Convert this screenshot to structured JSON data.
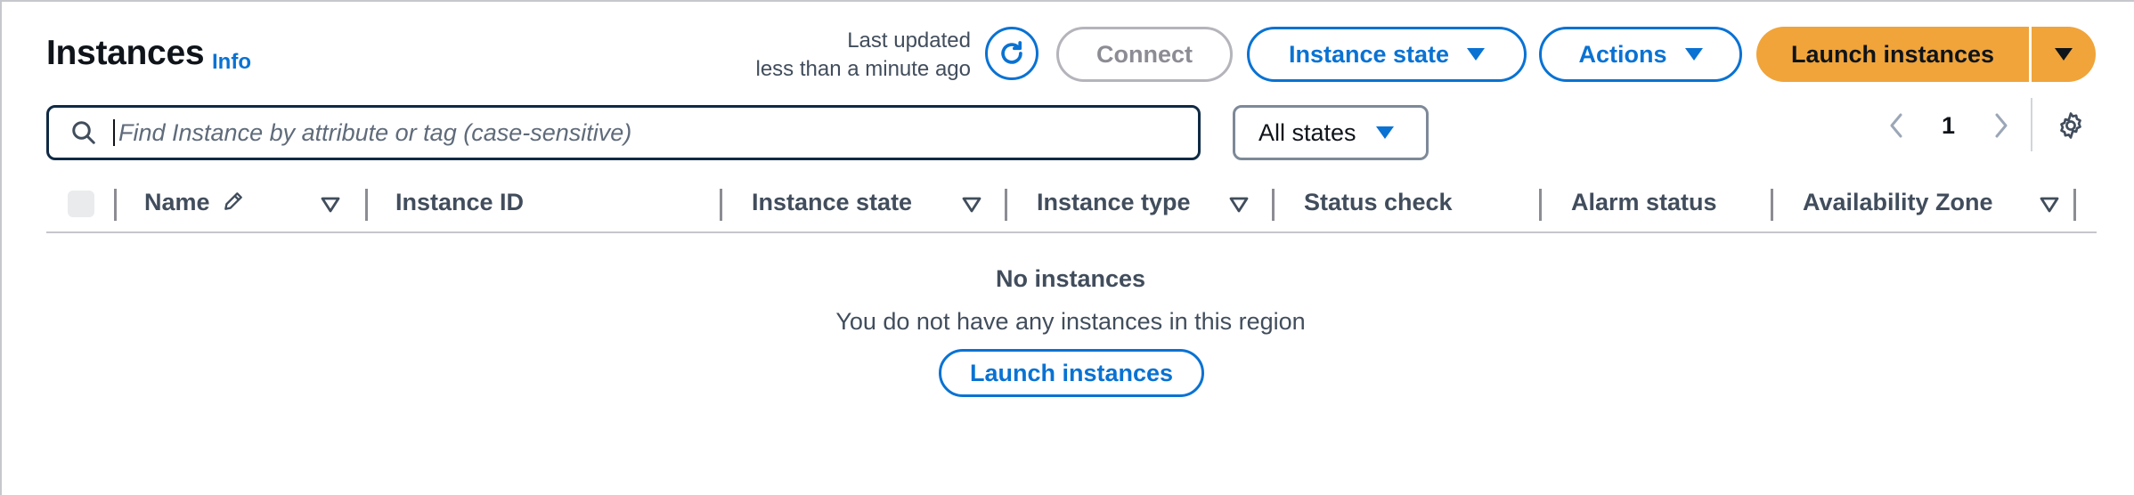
{
  "header": {
    "title": "Instances",
    "info_label": "Info",
    "last_updated_line1": "Last updated",
    "last_updated_line2": "less than a minute ago",
    "connect_label": "Connect",
    "instance_state_label": "Instance state",
    "actions_label": "Actions",
    "launch_label": "Launch instances"
  },
  "search": {
    "placeholder": "Find Instance by attribute or tag (case-sensitive)",
    "value": ""
  },
  "filter": {
    "selected": "All states"
  },
  "pagination": {
    "current_page": "1"
  },
  "table": {
    "columns": [
      {
        "label": "Name",
        "sortable": true,
        "editable": true
      },
      {
        "label": "Instance ID",
        "sortable": false
      },
      {
        "label": "Instance state",
        "sortable": true
      },
      {
        "label": "Instance type",
        "sortable": true
      },
      {
        "label": "Status check",
        "sortable": false
      },
      {
        "label": "Alarm status",
        "sortable": false
      },
      {
        "label": "Availability Zone",
        "sortable": true
      }
    ],
    "rows": []
  },
  "empty_state": {
    "title": "No instances",
    "description": "You do not have any instances in this region",
    "button_label": "Launch instances"
  },
  "colors": {
    "accent": "#0972d3",
    "primary_button": "#f0a43a",
    "text": "#0f141a",
    "muted_text": "#414d5c"
  },
  "icons": [
    "refresh-icon",
    "caret-down-icon",
    "search-icon",
    "chevron-left-icon",
    "chevron-right-icon",
    "settings-icon",
    "pencil-icon",
    "sort-icon"
  ]
}
